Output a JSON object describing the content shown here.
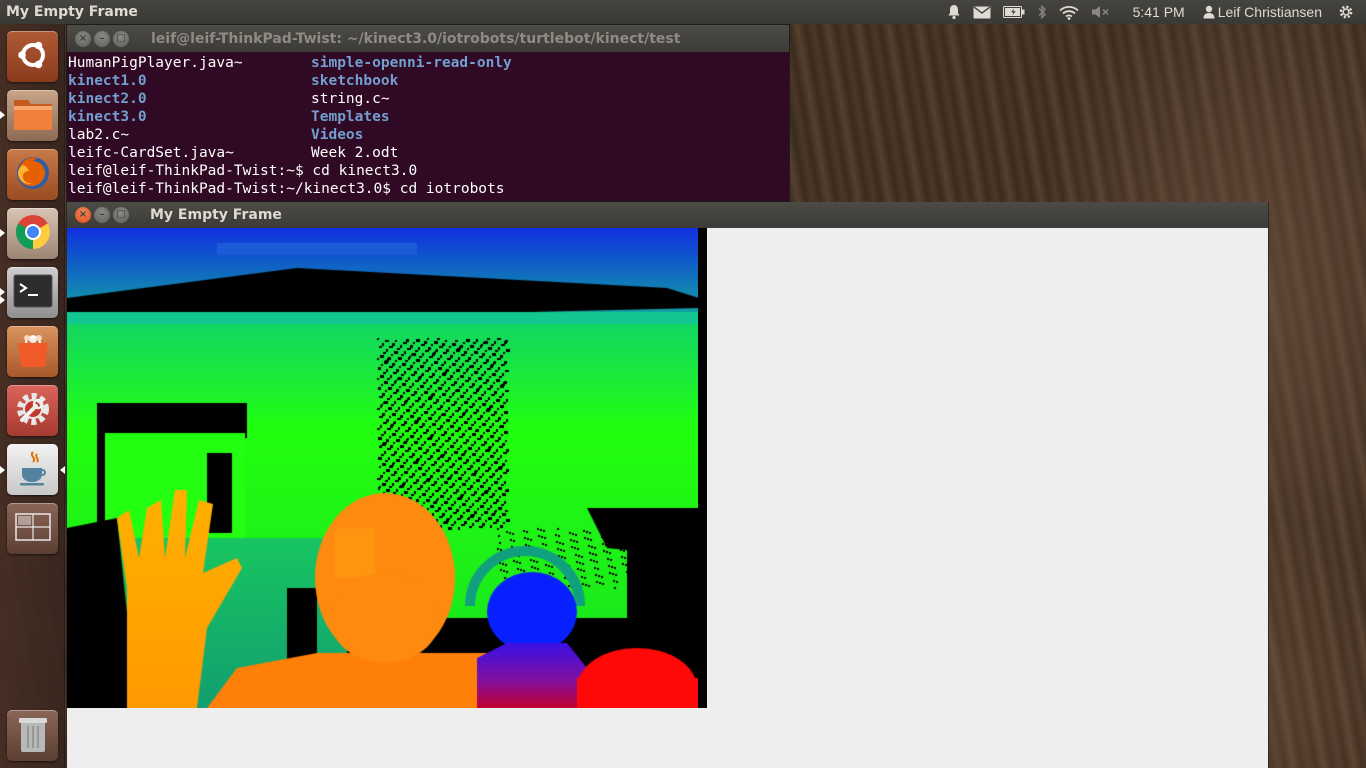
{
  "top_panel": {
    "app_title": "My Empty Frame",
    "clock": "5:41 PM",
    "user": "Leif Christiansen",
    "indicators": [
      "bell-icon",
      "mail-icon",
      "battery-icon",
      "bluetooth-icon",
      "wifi-icon",
      "volume-muted-icon",
      "user-icon",
      "power-gear-icon"
    ]
  },
  "launcher": {
    "items": [
      {
        "name": "dash-home",
        "icon": "ubuntu-logo-icon"
      },
      {
        "name": "files",
        "icon": "folder-icon"
      },
      {
        "name": "firefox",
        "icon": "firefox-icon"
      },
      {
        "name": "chrome",
        "icon": "chrome-icon"
      },
      {
        "name": "terminal",
        "icon": "terminal-icon"
      },
      {
        "name": "software-center",
        "icon": "shopping-bag-icon"
      },
      {
        "name": "system-settings",
        "icon": "settings-wrench-icon"
      },
      {
        "name": "java",
        "icon": "java-icon"
      },
      {
        "name": "workspace-switcher",
        "icon": "workspaces-icon"
      },
      {
        "name": "trash",
        "icon": "trash-icon"
      }
    ]
  },
  "terminal": {
    "title": "leif@leif-ThinkPad-Twist: ~/kinect3.0/iotrobots/turtlebot/kinect/test",
    "listing": [
      {
        "a": "HumanPigPlayer.java~",
        "a_dir": false,
        "b": "simple-openni-read-only",
        "b_dir": true
      },
      {
        "a": "kinect1.0",
        "a_dir": true,
        "b": "sketchbook",
        "b_dir": true
      },
      {
        "a": "kinect2.0",
        "a_dir": true,
        "b": "string.c~",
        "b_dir": false
      },
      {
        "a": "kinect3.0",
        "a_dir": true,
        "b": "Templates",
        "b_dir": true
      },
      {
        "a": "lab2.c~",
        "a_dir": false,
        "b": "Videos",
        "b_dir": true
      },
      {
        "a": "leifc-CardSet.java~",
        "a_dir": false,
        "b": "Week 2.odt",
        "b_dir": false
      }
    ],
    "commands": [
      "leif@leif-ThinkPad-Twist:~$ cd kinect3.0",
      "leif@leif-ThinkPad-Twist:~/kinect3.0$ cd iotrobots"
    ]
  },
  "frame": {
    "title": "My Empty Frame"
  },
  "colors": {
    "terminal_bg": "#300a24",
    "dir": "#729fcf",
    "panel": "#3c3b37",
    "close_button": "#df4a16",
    "frame_bg": "#eeeeee"
  }
}
